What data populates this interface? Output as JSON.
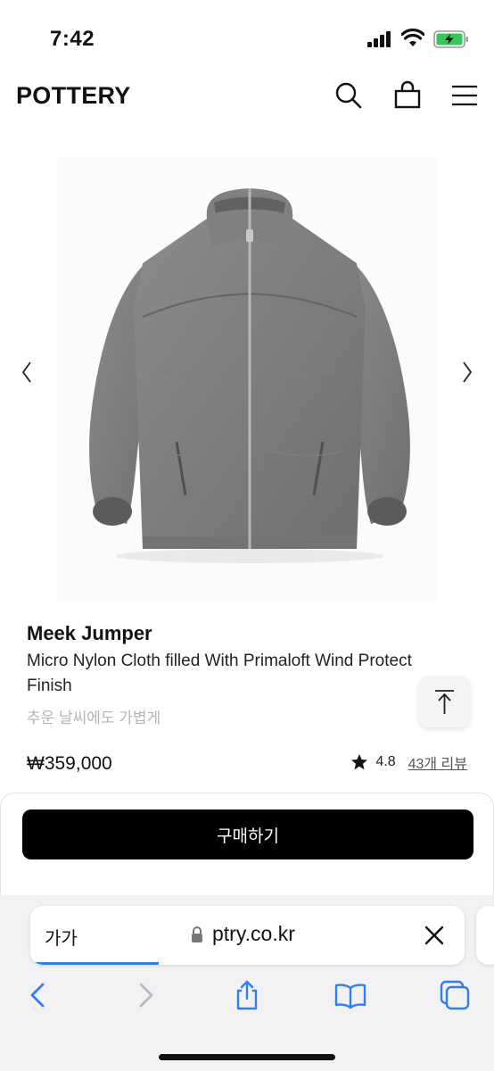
{
  "status_bar": {
    "time": "7:42"
  },
  "header": {
    "logo": "POTTERY"
  },
  "product": {
    "name": "Meek Jumper",
    "description": "Micro Nylon Cloth filled With Primaloft Wind Protect Finish",
    "tagline": "추운 날씨에도 가볍게",
    "price": "₩359,000",
    "rating": "4.8",
    "reviews": "43개 리뷰"
  },
  "buy_button": {
    "label": "구매하기"
  },
  "browser": {
    "text_size_label": "가가",
    "domain": "ptry.co.kr"
  },
  "colors": {
    "accent": "#2e7cf6",
    "primary_button": "#000000",
    "jacket": "#7a7b7d"
  }
}
